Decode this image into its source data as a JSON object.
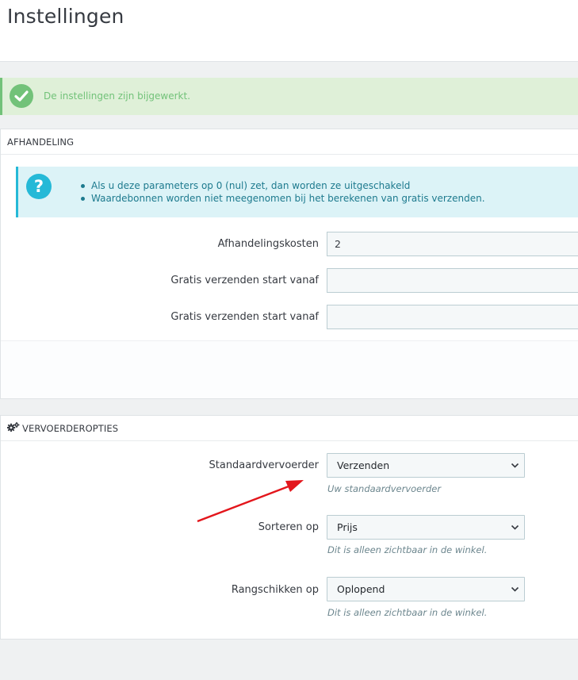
{
  "page": {
    "title": "Instellingen"
  },
  "success_alert": {
    "message": "De instellingen zijn bijgewerkt."
  },
  "handling_panel": {
    "heading": "Afhandeling",
    "info": {
      "items": [
        "Als u deze parameters op 0 (nul) zet, dan worden ze uitgeschakeld",
        "Waardebonnen worden niet meegenomen bij het berekenen van gratis verzenden."
      ]
    },
    "fields": [
      {
        "label": "Afhandelingskosten",
        "value": "2"
      },
      {
        "label": "Gratis verzenden start vanaf",
        "value": ""
      },
      {
        "label": "Gratis verzenden start vanaf",
        "value": ""
      }
    ]
  },
  "carrier_panel": {
    "heading": "Vervoerderopties",
    "fields": [
      {
        "label": "Standaardvervoerder",
        "selected": "Verzenden",
        "help": "Uw standaardvervoerder"
      },
      {
        "label": "Sorteren op",
        "selected": "Prijs",
        "help": "Dit is alleen zichtbaar in de winkel."
      },
      {
        "label": "Rangschikken op",
        "selected": "Oplopend",
        "help": "Dit is alleen zichtbaar in de winkel."
      }
    ]
  },
  "colors": {
    "success": "#72c279",
    "info": "#25b9d7",
    "annotation_arrow": "#e3161c"
  },
  "icons": {
    "success": "check-icon",
    "info": "question-icon",
    "carrier_heading": "cogs-icon",
    "select": "chevron-down-icon"
  }
}
